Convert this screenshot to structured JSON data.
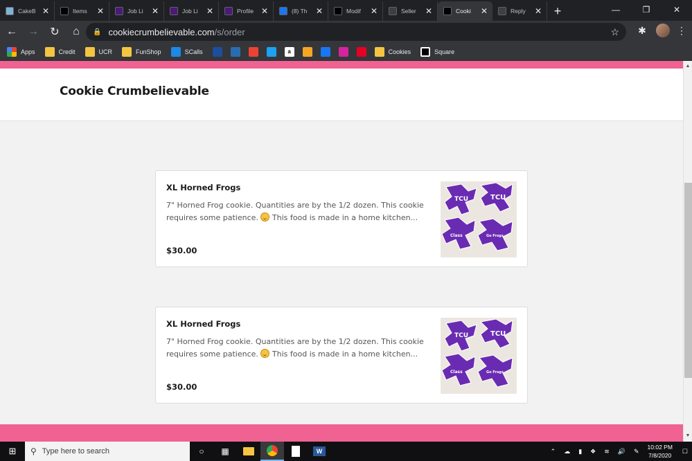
{
  "tabs": [
    {
      "title": "CakeB",
      "favicon": "cakeboss-icon",
      "color": "#7fb3d5",
      "active": false
    },
    {
      "title": "Items",
      "favicon": "square-icon",
      "color": "#000000",
      "active": false
    },
    {
      "title": "Job Li",
      "favicon": "tcu-icon",
      "color": "#4d1979",
      "active": false
    },
    {
      "title": "Job Li",
      "favicon": "tcu-icon",
      "color": "#4d1979",
      "active": false
    },
    {
      "title": "Profile",
      "favicon": "tcu-icon",
      "color": "#4d1979",
      "active": false
    },
    {
      "title": "(8) Th",
      "favicon": "facebook-icon",
      "color": "#1877f2",
      "active": false
    },
    {
      "title": "Modif",
      "favicon": "square-icon",
      "color": "#000000",
      "active": false
    },
    {
      "title": "Seller",
      "favicon": "square-icon",
      "color": "#3c4043",
      "active": false
    },
    {
      "title": "Cooki",
      "favicon": "square-icon",
      "color": "#000000",
      "active": true
    },
    {
      "title": "Reply",
      "favicon": "square-icon",
      "color": "#3c4043",
      "active": false
    }
  ],
  "address": {
    "domain": "cookiecrumbelievable.com",
    "path": "/s/order"
  },
  "bookmarks": [
    {
      "label": "Apps",
      "icon": "apps-grid-icon",
      "color": "#e94235"
    },
    {
      "label": "Credit",
      "icon": "folder-icon",
      "color": "#f4c542"
    },
    {
      "label": "UCR",
      "icon": "folder-icon",
      "color": "#f4c542"
    },
    {
      "label": "FunShop",
      "icon": "folder-icon",
      "color": "#f4c542"
    },
    {
      "label": "SCalls",
      "icon": "star-badge-icon",
      "color": "#1e88e5"
    },
    {
      "label": "",
      "icon": "wellsfargo-icon",
      "color": "#1d4e9e"
    },
    {
      "label": "",
      "icon": "fw-icon",
      "color": "#2b6cb0"
    },
    {
      "label": "",
      "icon": "gmail-icon",
      "color": "#ea4335"
    },
    {
      "label": "",
      "icon": "twitter-icon",
      "color": "#1da1f2"
    },
    {
      "label": "",
      "icon": "amazon-icon",
      "color": "#ffffff"
    },
    {
      "label": "",
      "icon": "layers-icon",
      "color": "#f5a623"
    },
    {
      "label": "",
      "icon": "facebook-icon",
      "color": "#1877f2"
    },
    {
      "label": "",
      "icon": "instagram-icon",
      "color": "#d6249f"
    },
    {
      "label": "",
      "icon": "pinterest-icon",
      "color": "#e60023"
    },
    {
      "label": "Cookies",
      "icon": "folder-icon",
      "color": "#f4c542"
    },
    {
      "label": "Square",
      "icon": "square-icon",
      "color": "#000000"
    }
  ],
  "page": {
    "brand_color": "#f06292",
    "site_title": "Cookie Crumbelievable",
    "items": [
      {
        "name": "XL Horned Frogs",
        "description_before_emoji": "7\" Horned Frog cookie. Quantities are by the 1/2 dozen. This cookie requires some patience. ",
        "description_after_emoji": " This food is made in a home kitchen...",
        "price": "$30.00"
      },
      {
        "name": "XL Horned Frogs",
        "description_before_emoji": "7\" Horned Frog cookie. Quantities are by the 1/2 dozen. This cookie requires some patience. ",
        "description_after_emoji": " This food is made in a home kitchen...",
        "price": "$30.00"
      }
    ]
  },
  "taskbar": {
    "search_placeholder": "Type here to search",
    "time": "10:02 PM",
    "date": "7/8/2020"
  }
}
